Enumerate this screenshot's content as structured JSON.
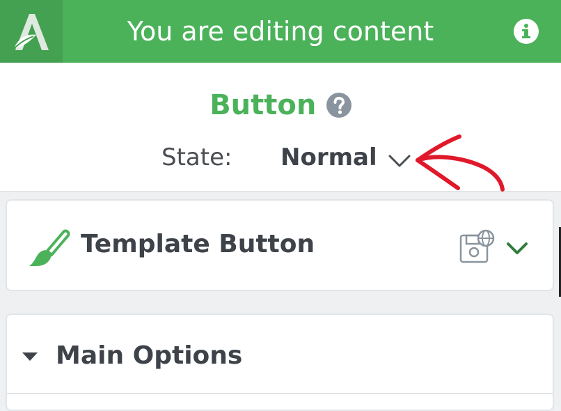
{
  "topbar": {
    "logo_icon": "divi-leaf-logo-icon",
    "title": "You are editing content",
    "info_icon": "info-icon",
    "background_color": "#4bb25a",
    "logo_background_color": "#44a152"
  },
  "module": {
    "name": "Button",
    "help_icon": "question-circle-icon",
    "accent_color": "#4bb25a"
  },
  "state": {
    "label": "State:",
    "value": "Normal",
    "chevron_icon": "chevron-down-icon",
    "annotation": "red-hand-drawn-arrow"
  },
  "template_card": {
    "icon": "paintbrush-icon",
    "label": "Template Button",
    "save_icon": "save-global-icon",
    "chevron_icon": "chevron-down-icon"
  },
  "main_options": {
    "toggle_icon": "caret-down-icon",
    "label": "Main Options"
  }
}
